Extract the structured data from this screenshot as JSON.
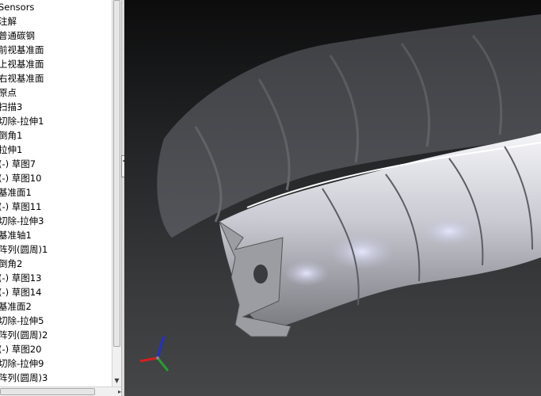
{
  "feature_tree": {
    "items": [
      {
        "label": "Sensors"
      },
      {
        "label": "注解"
      },
      {
        "label": "普通碳钢"
      },
      {
        "label": "前视基准面"
      },
      {
        "label": "上视基准面"
      },
      {
        "label": "右视基准面"
      },
      {
        "label": "原点"
      },
      {
        "label": "扫描3"
      },
      {
        "label": "切除-拉伸1"
      },
      {
        "label": "倒角1"
      },
      {
        "label": "拉伸1"
      },
      {
        "label": "(-) 草图7"
      },
      {
        "label": "(-) 草图10"
      },
      {
        "label": "基准面1"
      },
      {
        "label": "(-) 草图11"
      },
      {
        "label": "切除-拉伸3"
      },
      {
        "label": "基准轴1"
      },
      {
        "label": "阵列(圆周)1"
      },
      {
        "label": "倒角2"
      },
      {
        "label": "(-) 草图13"
      },
      {
        "label": "(-) 草图14"
      },
      {
        "label": "基准面2"
      },
      {
        "label": "切除-拉伸5"
      },
      {
        "label": "阵列(圆周)2"
      },
      {
        "label": "(-) 草图20"
      },
      {
        "label": "切除-拉伸9"
      },
      {
        "label": "阵列(圆周)3"
      }
    ]
  },
  "scrollbars": {
    "vertical_down_arrow": "▼",
    "horizontal_right_arrow": "▸"
  },
  "splitter": {
    "toggle_glyph": "◂◂"
  },
  "viewport": {
    "triad_colors": {
      "x": "#d42020",
      "y": "#20a030",
      "z": "#2030d0"
    },
    "background_top": "#0c0c0d",
    "background_bottom": "#454648"
  }
}
